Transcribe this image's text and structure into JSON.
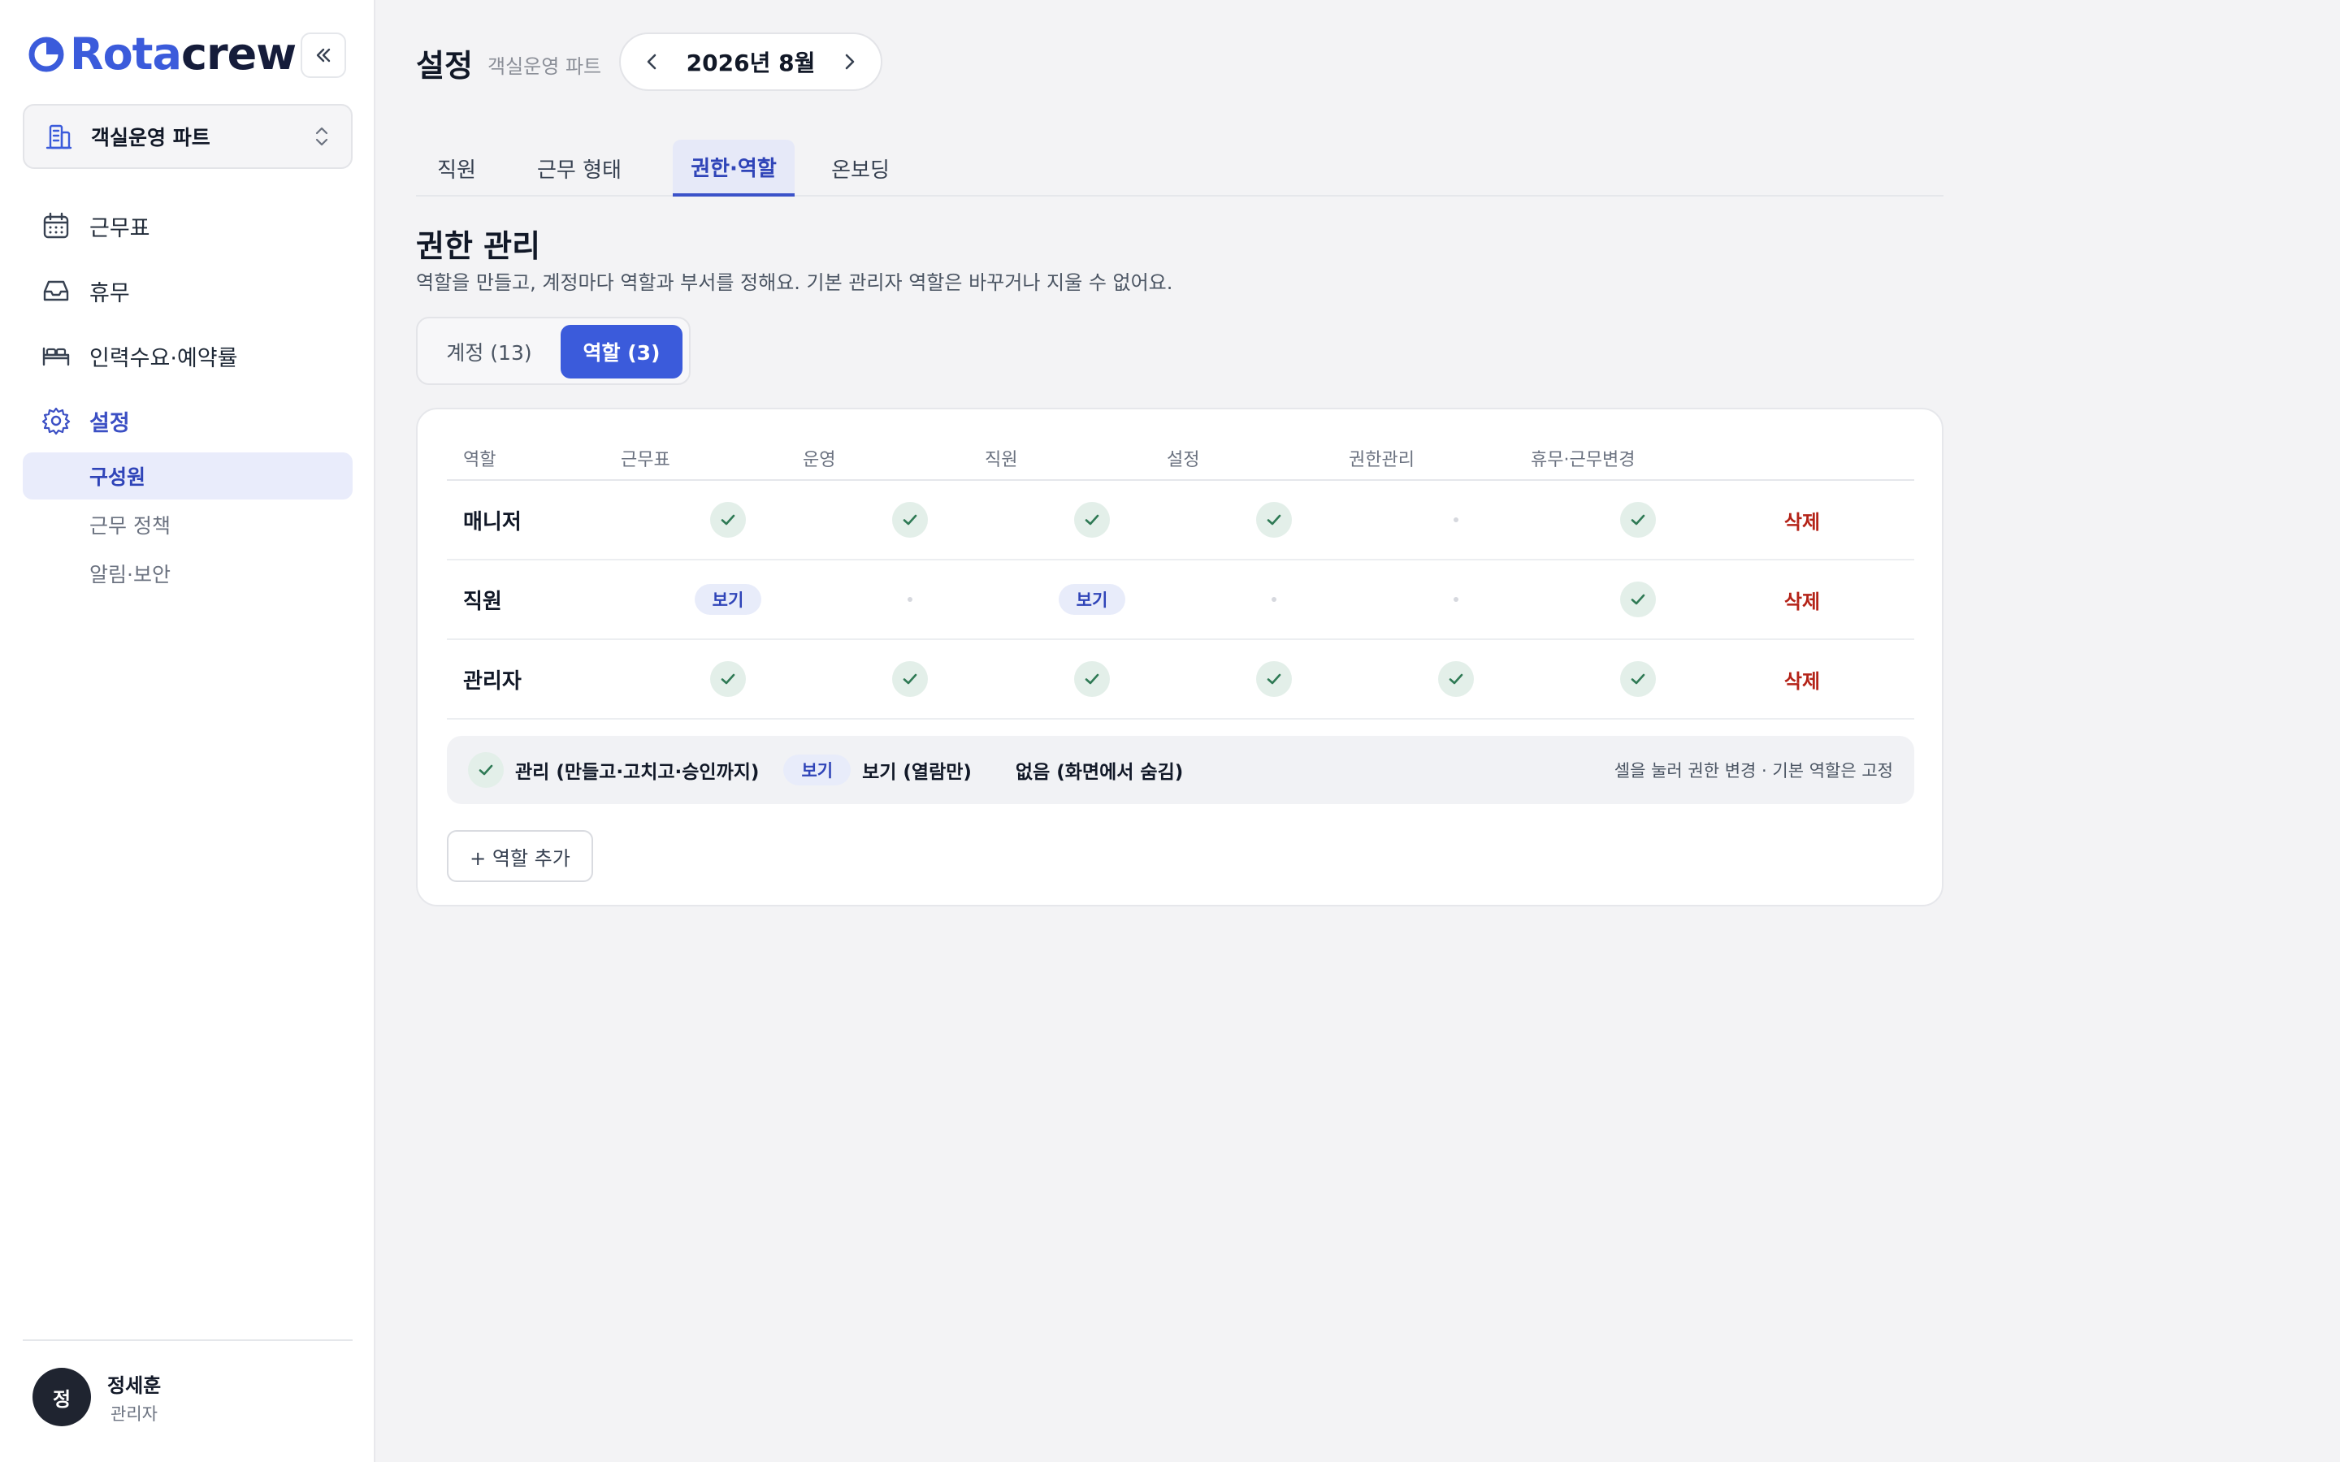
{
  "brand": {
    "part1": "Rota",
    "part2": "crew",
    "accent": "#3b5bdb",
    "dark": "#151c3a"
  },
  "sidebar": {
    "org_selector": {
      "label": "객실운영 파트",
      "icon": "building-icon"
    },
    "nav": [
      {
        "label": "근무표",
        "icon": "calendar-icon"
      },
      {
        "label": "휴무",
        "icon": "inbox-icon"
      },
      {
        "label": "인력수요·예약률",
        "icon": "bed-icon"
      },
      {
        "label": "설정",
        "icon": "gear-icon",
        "active": true
      }
    ],
    "sub_nav": [
      {
        "label": "구성원",
        "active": true
      },
      {
        "label": "근무 정책"
      },
      {
        "label": "알림·보안"
      }
    ],
    "user": {
      "initial": "정",
      "name": "정세훈",
      "role": "관리자"
    }
  },
  "header": {
    "title": "설정",
    "subtitle": "객실운영 파트",
    "month": "2026년 8월"
  },
  "tabs": [
    {
      "label": "직원"
    },
    {
      "label": "근무 형태"
    },
    {
      "label": "권한·역할",
      "active": true
    },
    {
      "label": "온보딩"
    }
  ],
  "section": {
    "title": "권한 관리",
    "description": "역할을 만들고, 계정마다 역할과 부서를 정해요. 기본 관리자 역할은 바꾸거나 지울 수 없어요."
  },
  "segmented": {
    "accounts": "계정 (13)",
    "roles": "역할 (3)"
  },
  "table": {
    "headers": [
      "역할",
      "근무표",
      "운영",
      "직원",
      "설정",
      "권한관리",
      "휴무·근무변경"
    ],
    "rows": [
      {
        "role": "매니저",
        "perms": [
          "manage",
          "manage",
          "manage",
          "manage",
          "none",
          "manage"
        ],
        "delete": "삭제"
      },
      {
        "role": "직원",
        "perms": [
          "view",
          "none",
          "view",
          "none",
          "none",
          "manage"
        ],
        "delete": "삭제"
      },
      {
        "role": "관리자",
        "perms": [
          "manage",
          "manage",
          "manage",
          "manage",
          "manage",
          "manage"
        ],
        "delete": "삭제"
      }
    ],
    "view_badge": "보기"
  },
  "legend": {
    "manage": "관리 (만들고·고치고·승인까지)",
    "view_badge": "보기",
    "view": "보기 (열람만)",
    "none": "없음 (화면에서 숨김)",
    "hint": "셀을 눌러 권한 변경 · 기본 역할은 고정"
  },
  "add_role_button": "+ 역할 추가",
  "colors": {
    "primary": "#3b5bdb",
    "check_bg": "#e3efe9",
    "check_fg": "#2f7a55",
    "danger": "#b42318"
  }
}
